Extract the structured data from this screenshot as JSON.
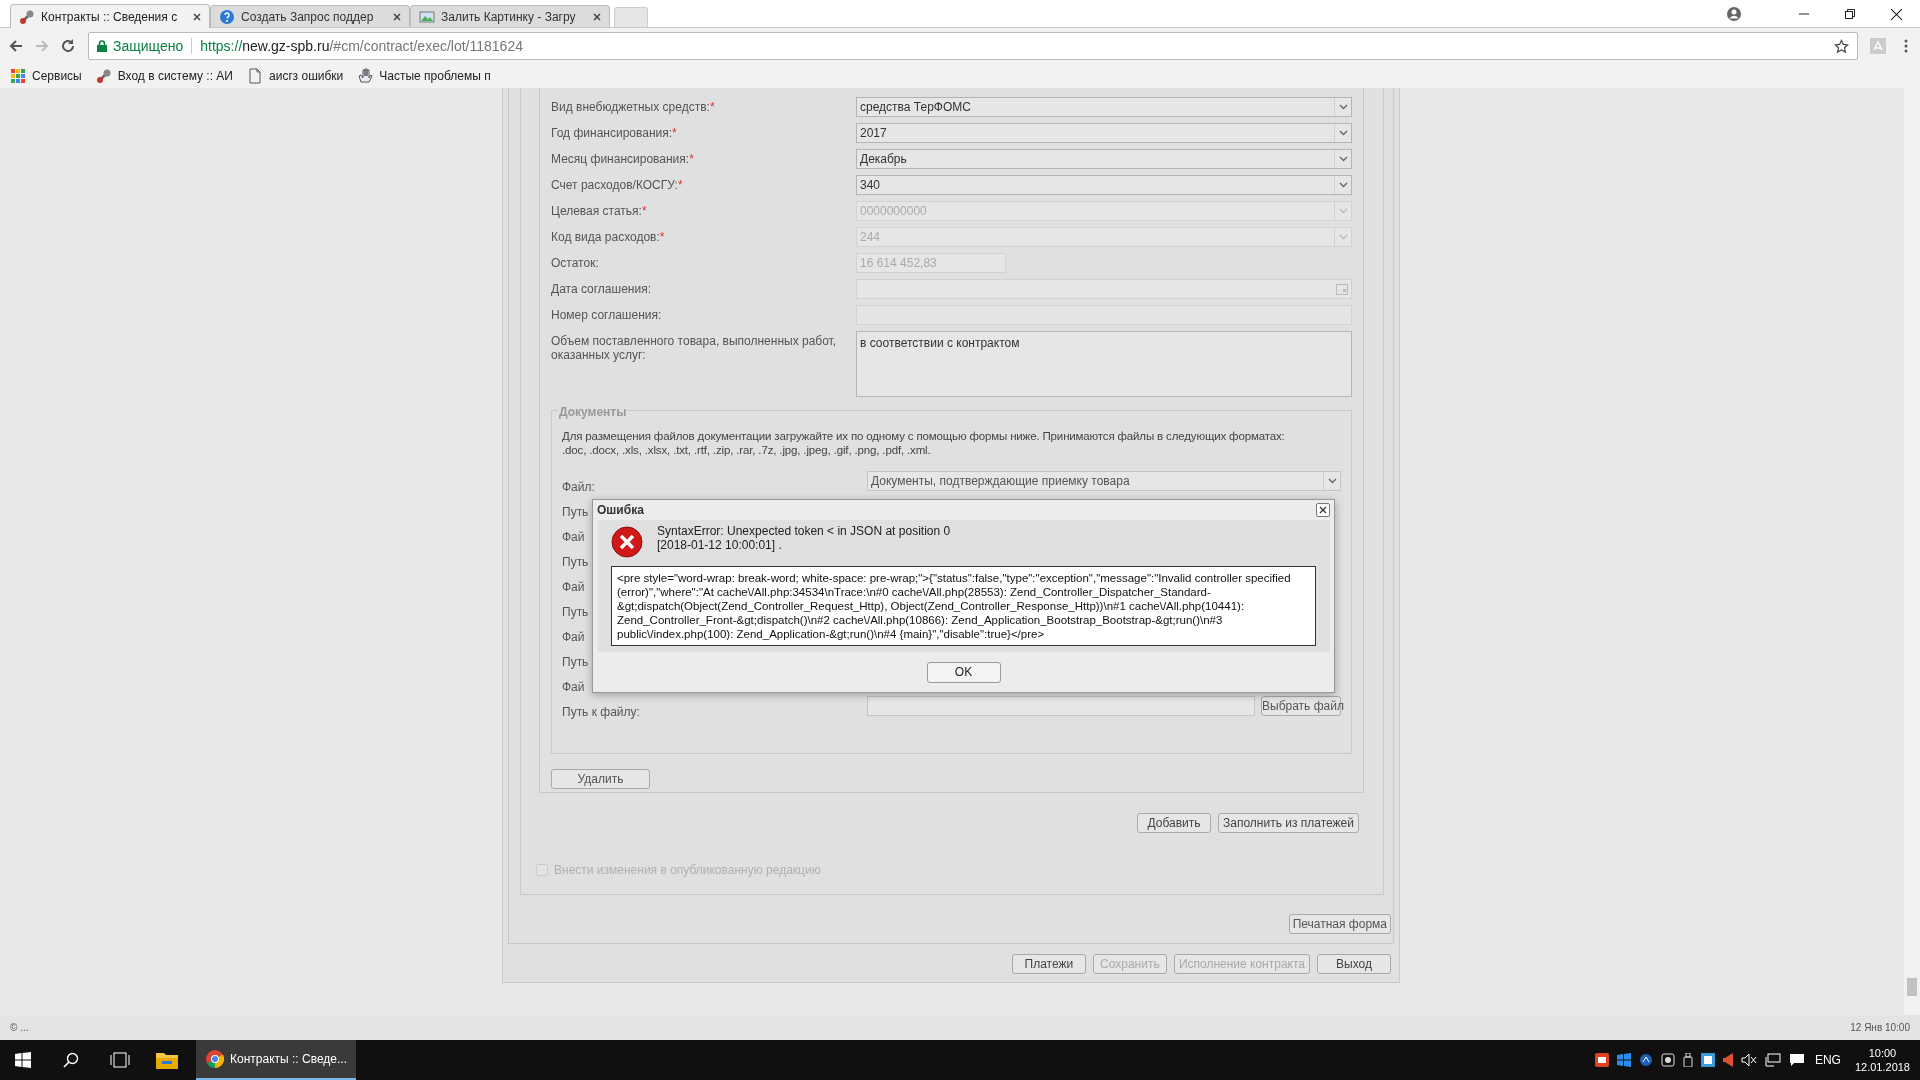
{
  "browser": {
    "tabs": [
      {
        "title": "Контракты :: Сведения с",
        "selected": true
      },
      {
        "title": "Создать Запрос поддер",
        "selected": false
      },
      {
        "title": "Залить Картинку - Загру",
        "selected": false
      }
    ],
    "secure_label": "Защищено",
    "url": {
      "scheme": "https://",
      "host": "new.gz-spb.ru",
      "path": "/#cm/contract/exec/lot/1181624"
    },
    "bookmarks": [
      {
        "label": "Сервисы"
      },
      {
        "label": "Вход в систему :: АИ"
      },
      {
        "label": "аисгз ошибки"
      },
      {
        "label": "Частые проблемы п"
      }
    ]
  },
  "form": {
    "rows": [
      {
        "label": "Вид внебюджетных средств:",
        "required_mark": "*",
        "kind": "select",
        "value": "средства ТерФОМС",
        "disabled": false
      },
      {
        "label": "Год финансирования:",
        "required_mark": "*",
        "kind": "select",
        "value": "2017",
        "disabled": false
      },
      {
        "label": "Месяц финансирования:",
        "required_mark": "*",
        "kind": "select",
        "value": "Декабрь",
        "disabled": false
      },
      {
        "label": "Счет расходов/КОСГУ:",
        "required_mark": "*",
        "kind": "select",
        "value": "340",
        "disabled": false
      },
      {
        "label": "Целевая статья:",
        "required_mark": "*",
        "kind": "select",
        "value": "0000000000",
        "disabled": true
      },
      {
        "label": "Код вида расходов:",
        "required_mark": "*",
        "kind": "select",
        "value": "244",
        "disabled": true
      },
      {
        "label": "Остаток:",
        "kind": "short",
        "value": "16 614 452,83",
        "disabled": true
      },
      {
        "label": "Дата соглашения:",
        "kind": "date",
        "disabled": true
      },
      {
        "label": "Номер соглашения:",
        "kind": "text",
        "disabled": true
      },
      {
        "label": "Объем поставленного товара, выполненных работ, оказанных услуг:",
        "kind": "textarea",
        "value": "в соответствии с контрактом",
        "disabled": false
      }
    ]
  },
  "documents": {
    "legend": "Документы",
    "description": "Для размещения файлов документации загружайте их по одному с помощью формы ниже. Принимаются файлы в следующих форматах: .doc, .docx, .xls, .xlsx, .txt, .rtf, .zip, .rar, .7z, .jpg, .jpeg, .gif, .png, .pdf, .xml.",
    "rows": [
      {
        "label": "Файл:",
        "kind": "select",
        "value": "Документы, подтверждающие приемку товара"
      },
      {
        "label": "Путь",
        "kind": "label"
      },
      {
        "label": "Фай",
        "kind": "label"
      },
      {
        "label": "Путь",
        "kind": "label"
      },
      {
        "label": "Фай",
        "kind": "label"
      },
      {
        "label": "Путь",
        "kind": "label"
      },
      {
        "label": "Фай",
        "kind": "label"
      },
      {
        "label": "Путь",
        "kind": "label"
      },
      {
        "label": "Фай",
        "kind": "label"
      },
      {
        "label": "Путь к файлу:",
        "kind": "file",
        "button": "Выбрать файл"
      }
    ],
    "delete_button": "Удалить"
  },
  "payment_buttons": [
    {
      "label": "Добавить",
      "disabled": false
    },
    {
      "label": "Заполнить из платежей",
      "disabled": false
    }
  ],
  "publish_checkbox": {
    "label": "Внести изменения в опубликованную редакцию",
    "checked": false,
    "disabled": true
  },
  "print_button": "Печатная форма",
  "footer_buttons": [
    {
      "label": "Платежи",
      "disabled": false
    },
    {
      "label": "Сохранить",
      "disabled": true
    },
    {
      "label": "Исполнение контракта",
      "disabled": true
    },
    {
      "label": "Выход",
      "disabled": false
    }
  ],
  "dialog": {
    "title": "Ошибка",
    "message": "SyntaxError: Unexpected token < in JSON at position 0",
    "timestamp": "[2018-01-12 10:00:01] .",
    "details": "<pre style=\"word-wrap: break-word; white-space: pre-wrap;\">{\"status\":false,\"type\":\"exception\",\"message\":\"Invalid controller specified (error)\",\"where\":\"At cache\\/All.php:34534\\nTrace:\\n#0 cache\\/All.php(28553): Zend_Controller_Dispatcher_Standard-&gt;dispatch(Object(Zend_Controller_Request_Http), Object(Zend_Controller_Response_Http))\\n#1 cache\\/All.php(10441): Zend_Controller_Front-&gt;dispatch()\\n#2 cache\\/All.php(10866): Zend_Application_Bootstrap_Bootstrap-&gt;run()\\n#3 public\\/index.php(100): Zend_Application-&gt;run()\\n#4 {main}\",\"disable\":true}</pre>",
    "ok_button": "OK"
  },
  "status_bar": {
    "left": "© ...",
    "right": "12 Янв 10:00"
  },
  "taskbar": {
    "app_title": "Контракты :: Сведе...",
    "language": "ENG",
    "time": "10:00",
    "date": "12.01.2018"
  }
}
